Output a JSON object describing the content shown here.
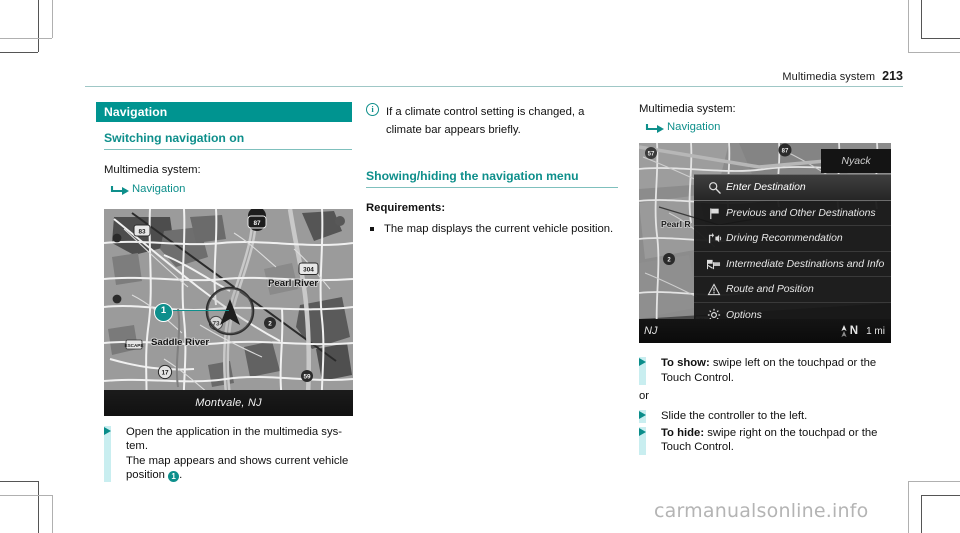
{
  "page": {
    "running_head": "Multimedia system",
    "page_number": "213",
    "watermark": "carmanualsonline.info"
  },
  "column_left": {
    "chapter_band": "Navigation",
    "heading": "Switching navigation on",
    "intro": "Multimedia system:",
    "menu_path": "Navigation",
    "map": {
      "city_label": "Montvale, NJ",
      "callout_number": "1",
      "place_labels": [
        "Pearl River",
        "Saddle River"
      ],
      "route_shields": [
        "83",
        "87",
        "304",
        "73",
        "2",
        "17",
        "59"
      ]
    },
    "steps": [
      {
        "lines": [
          "Open the application in the multimedia sys-",
          "tem.",
          "The map appears and shows current vehicle",
          "position "
        ],
        "callout": "1",
        "trailing": "."
      }
    ]
  },
  "column_middle": {
    "note": {
      "icon": "info-icon",
      "text": "If a climate control setting is changed, a climate bar appears briefly."
    },
    "heading": "Showing/hiding the navigation menu",
    "requirements_label": "Requirements:",
    "requirements": [
      "The map displays the current vehicle position."
    ]
  },
  "column_right": {
    "intro": "Multimedia system:",
    "menu_path": "Navigation",
    "screenshot": {
      "place_label_corner": "Nyack",
      "place_label_map": "Pearl R",
      "menu_items": [
        {
          "label": "Enter Destination",
          "icon": "magnifier-icon",
          "selected": true
        },
        {
          "label": "Previous and Other Destinations",
          "icon": "flag-icon",
          "selected": false
        },
        {
          "label": "Driving Recommendation",
          "icon": "speaker-arrow-icon",
          "selected": false
        },
        {
          "label": "Intermediate Destinations and Info",
          "icon": "checkered-flags-icon",
          "selected": false
        },
        {
          "label": "Route and Position",
          "icon": "warning-triangle-icon",
          "selected": false
        },
        {
          "label": "Options",
          "icon": "gear-icon",
          "selected": false
        }
      ],
      "status_bar": {
        "state": "NJ",
        "compass": "N",
        "scale": "1 mi"
      }
    },
    "steps": [
      {
        "bold": "To show:",
        "rest": " swipe left on the touchpad or the Touch Control."
      }
    ],
    "or_label": "or",
    "steps2": [
      {
        "bold": "",
        "rest": "Slide the controller to the left."
      },
      {
        "bold": "To hide:",
        "rest": " swipe right on the touchpad or the Touch Control."
      }
    ]
  },
  "colors": {
    "teal": "#009490",
    "teal_text": "#0e8f8b",
    "teal_light": "#c9eef0",
    "rule": "#9fc7c6"
  }
}
